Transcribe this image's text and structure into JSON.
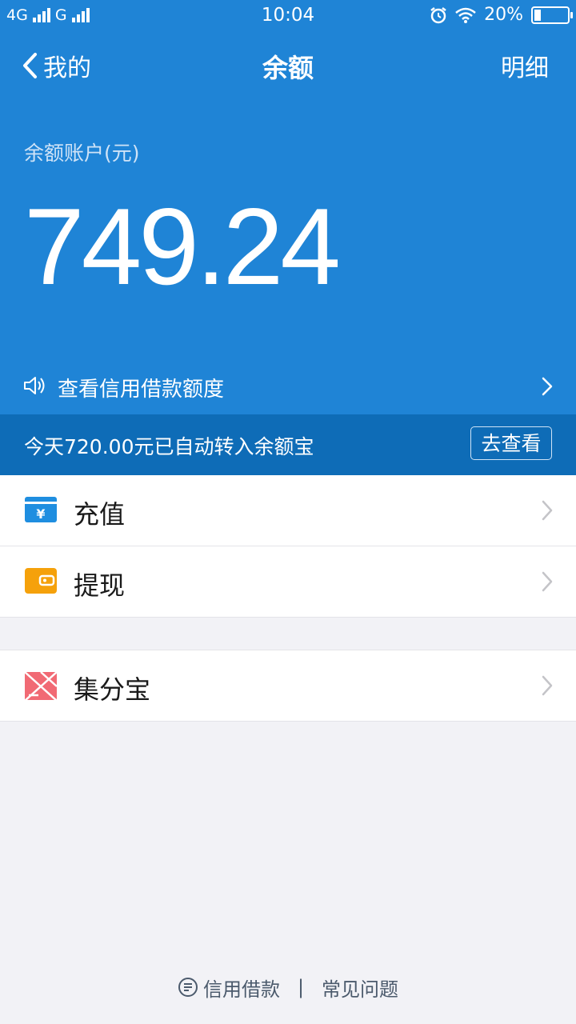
{
  "status_bar": {
    "network_1": "4G",
    "network_2": "G",
    "time": "10:04",
    "battery": "20%",
    "battery_level": 0.2
  },
  "nav": {
    "back_label": "我的",
    "title": "余额",
    "right_label": "明细"
  },
  "balance": {
    "label": "余额账户(元)",
    "amount": "749.24"
  },
  "credit_link": {
    "label": "查看信用借款额度"
  },
  "notice": {
    "text": "今天720.00元已自动转入余额宝",
    "button": "去查看"
  },
  "list_primary": [
    {
      "label": "充值",
      "icon": "recharge-yuan-icon",
      "icon_color": "#1f8ee0"
    },
    {
      "label": "提现",
      "icon": "wallet-icon",
      "icon_color": "#f5a10b"
    }
  ],
  "list_secondary": [
    {
      "label": "集分宝",
      "icon": "jifenbao-icon",
      "icon_color": "#f16a74"
    }
  ],
  "footer": {
    "link_1": "信用借款",
    "separator": "|",
    "link_2": "常见问题"
  }
}
